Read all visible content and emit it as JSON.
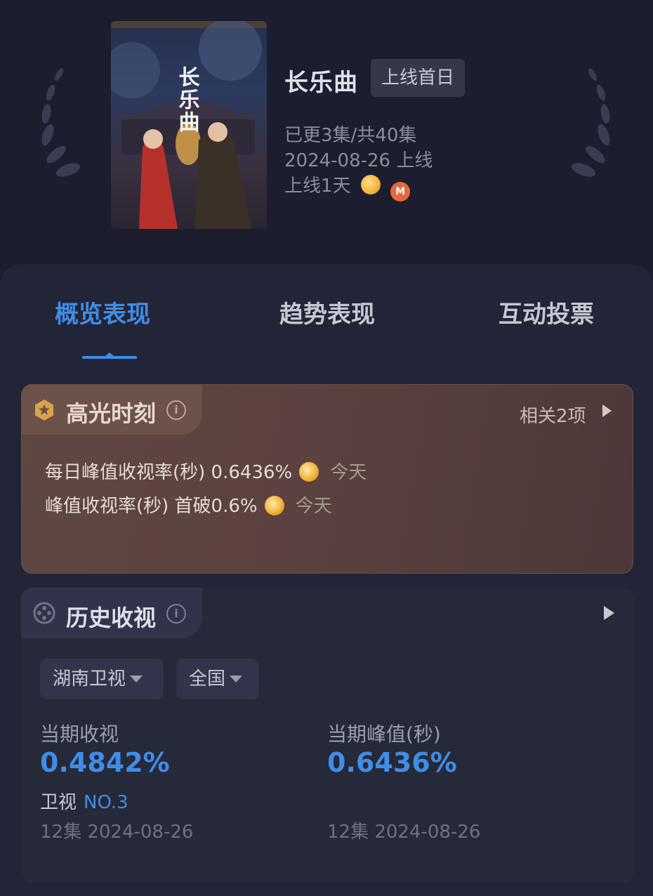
{
  "show": {
    "title": "长乐曲",
    "badge": "上线首日",
    "episodes": "已更3集/共40集",
    "air_date": "2024-08-26 上线",
    "days_online": "上线1天",
    "poster_text": "长乐曲",
    "platforms": [
      "hunan-tv-logo",
      "mango-tv-logo"
    ]
  },
  "tabs": [
    {
      "label": "概览表现",
      "active": true
    },
    {
      "label": "趋势表现",
      "active": false
    },
    {
      "label": "互动投票",
      "active": false
    }
  ],
  "highlight": {
    "title": "高光时刻",
    "more": "相关2项",
    "rows": [
      {
        "text": "每日峰值收视率(秒) 0.6436%",
        "time": "今天"
      },
      {
        "text": "峰值收视率(秒) 首破0.6%",
        "time": "今天"
      }
    ]
  },
  "history": {
    "title": "历史收视",
    "filters": {
      "channel": "湖南卫视",
      "region": "全国"
    },
    "current_rating_label": "当期收视",
    "current_rating": "0.4842%",
    "peak_label": "当期峰值(秒)",
    "peak_value": "0.6436%",
    "rank_label": "卫视",
    "rank_value": "NO.3",
    "episode_left": "12集 2024-08-26",
    "episode_right": "12集 2024-08-26"
  },
  "colors": {
    "accent": "#3f8de6",
    "background": "#1c1d2e"
  }
}
